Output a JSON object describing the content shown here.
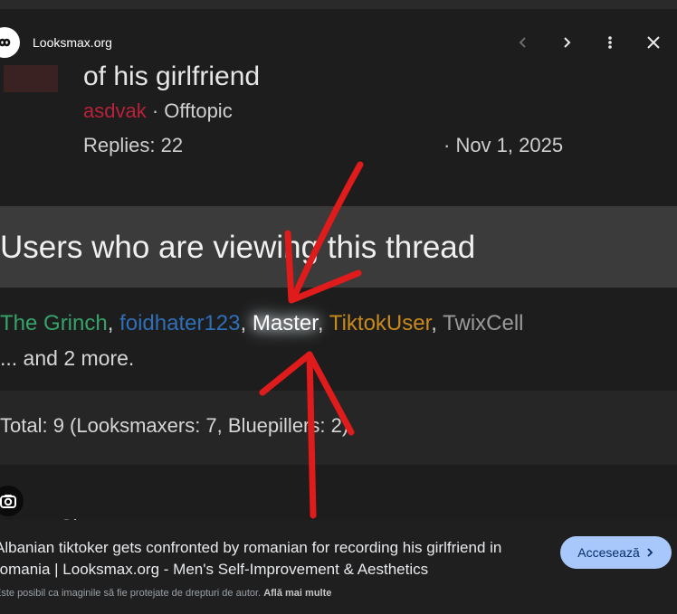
{
  "header": {
    "site_name": "Looksmax.org",
    "icons": [
      "chevron-left-icon",
      "chevron-right-icon",
      "more-vert-icon",
      "close-icon"
    ]
  },
  "screenshot": {
    "thread_title": "of his girlfriend",
    "author": "asdvak",
    "separator": " · ",
    "forum": "Offtopic",
    "replies": "Replies: 22",
    "date": "· Nov 1, 2025",
    "viewing_title": "Users who are viewing this thread",
    "users": [
      {
        "name": "The Grinch",
        "color": "#37a36b"
      },
      {
        "name": "foidhater123",
        "color": "#2f6fb8"
      },
      {
        "name": "Master",
        "color": "#ffffff"
      },
      {
        "name": "TiktokUser",
        "color": "#c98a1c"
      },
      {
        "name": "TwixCell",
        "color": "#9a9a9a"
      }
    ],
    "comma": ", ",
    "more": "... and 2 more.",
    "total": "Total: 9 (Looksmaxers: 7, Bluepillers: 2)",
    "partial_text": "Sh",
    "annotation_color": "#e01b1b"
  },
  "caption": {
    "title": "Albanian tiktoker gets confronted by romanian for recording his girlfriend in romania | Looksmax.org - Men's Self-Improvement & Aesthetics",
    "visit_button": "Accesează",
    "copyright_text": "Este posibil ca imaginile să fie protejate de drepturi de autor.",
    "learn_more": "Află mai multe"
  },
  "colors": {
    "background": "#1f1f1f",
    "accent_button": "#a8c7fa"
  }
}
